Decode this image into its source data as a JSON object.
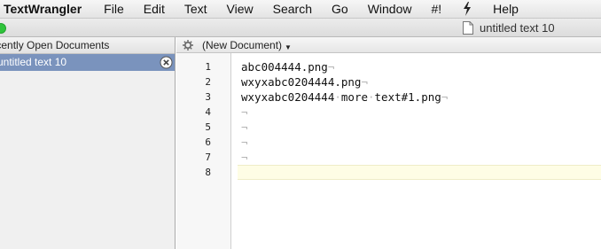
{
  "menubar": {
    "app": "TextWrangler",
    "items": [
      "File",
      "Edit",
      "Text",
      "View",
      "Search",
      "Go",
      "Window",
      "#!"
    ],
    "script_icon": "script-icon",
    "help": "Help"
  },
  "window": {
    "title": "untitled text 10"
  },
  "sidebar": {
    "header": "Recently Open Documents",
    "documents": [
      {
        "label": "untitled text 10",
        "selected": true
      }
    ]
  },
  "toolbar": {
    "document_popup": "(New Document)"
  },
  "editor": {
    "line_numbers": [
      "1",
      "2",
      "3",
      "4",
      "5",
      "6",
      "7",
      "8"
    ],
    "lines": [
      "abc004444.png",
      "wxyxabc0204444.png",
      "wxyxabc0204444 more text#1.png",
      "",
      "",
      "",
      "",
      ""
    ],
    "line_end_marker": "¬",
    "space_marker": "·",
    "current_line": 8
  },
  "colors": {
    "selection": "#7a93bd",
    "current_line_highlight": "#fefde5",
    "invisibles": "#b5b5b5"
  }
}
